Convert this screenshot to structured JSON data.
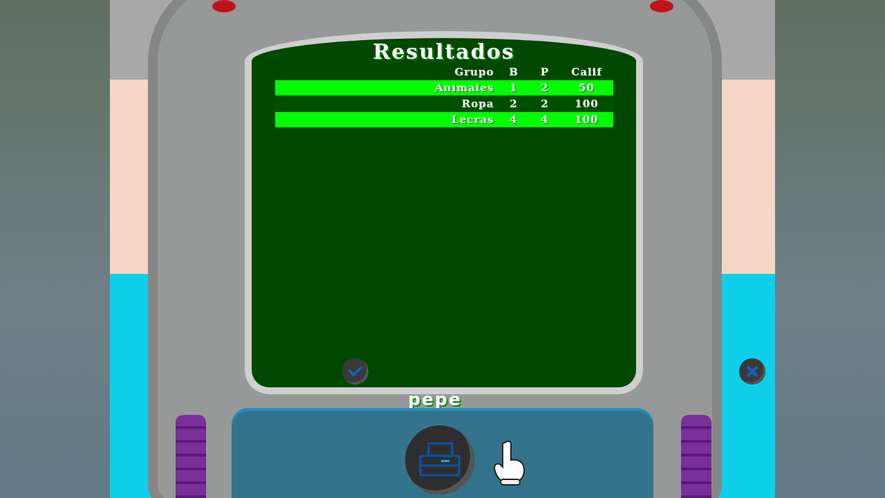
{
  "title": "Resultados",
  "table": {
    "columns": [
      "Grupo",
      "B",
      "P",
      "Calif"
    ],
    "rows": [
      {
        "cells": [
          "Animales",
          "1",
          "2",
          "50"
        ],
        "highlighted": true
      },
      {
        "cells": [
          "Ropa",
          "2",
          "2",
          "100"
        ],
        "highlighted": false
      },
      {
        "cells": [
          "Lecras",
          "4",
          "4",
          "100"
        ],
        "highlighted": true
      }
    ]
  },
  "user": "pepe"
}
